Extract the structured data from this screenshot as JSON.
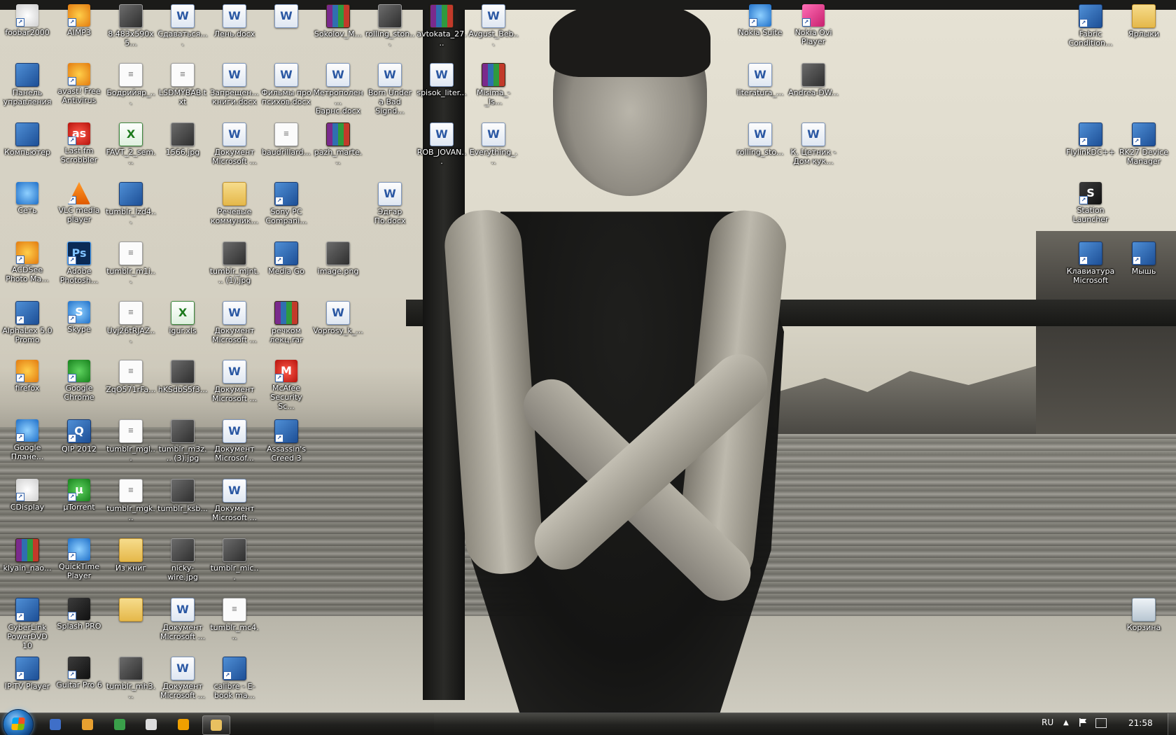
{
  "desktop": {
    "icons": [
      {
        "label": "foobar2000",
        "kind": "app",
        "icon": "foobar-icon"
      },
      {
        "label": "AIMP3",
        "kind": "app",
        "icon": "aimp-icon"
      },
      {
        "label": "8.483x590x5...",
        "kind": "img",
        "icon": "image-icon"
      },
      {
        "label": "Сдаваться....",
        "kind": "doc",
        "icon": "word-doc-icon"
      },
      {
        "label": "Лень.docx",
        "kind": "doc",
        "icon": "word-doc-icon"
      },
      {
        "label": "",
        "kind": "doc",
        "icon": "word-doc-icon"
      },
      {
        "label": "Sokolov_M...",
        "kind": "rar",
        "icon": "rar-archive-icon"
      },
      {
        "label": "rolling_ston...",
        "kind": "img",
        "icon": "image-icon"
      },
      {
        "label": "avtokata_27...",
        "kind": "rar",
        "icon": "rar-archive-icon"
      },
      {
        "label": "Avgust_Beb...",
        "kind": "doc",
        "icon": "word-doc-icon"
      },
      {
        "label": "Nokia Suite",
        "kind": "app",
        "icon": "nokia-suite-icon"
      },
      {
        "label": "Nokia Ovi Player",
        "kind": "app",
        "icon": "nokia-ovi-icon"
      },
      {
        "label": "Fabric Condition...",
        "kind": "app",
        "icon": "fabric-icon"
      },
      {
        "label": "Ярлыки",
        "kind": "folder",
        "icon": "folder-icon"
      },
      {
        "label": "Панель управления",
        "kind": "app",
        "icon": "control-panel-icon"
      },
      {
        "label": "avast! Free Antivirus",
        "kind": "app",
        "icon": "avast-icon"
      },
      {
        "label": "Бодрийяр_...",
        "kind": "txt",
        "icon": "text-file-icon"
      },
      {
        "label": "LSDMYBAB.txt",
        "kind": "txt",
        "icon": "text-file-icon"
      },
      {
        "label": "Запрещен... книги.docx",
        "kind": "doc",
        "icon": "word-doc-icon"
      },
      {
        "label": "Фильмы про психов.docx",
        "kind": "doc",
        "icon": "word-doc-icon"
      },
      {
        "label": "Метрополен... Барнс.docx",
        "kind": "doc",
        "icon": "word-doc-icon"
      },
      {
        "label": "Born Under a Bad Signd...",
        "kind": "doc",
        "icon": "word-doc-icon"
      },
      {
        "label": "spisok_liter...",
        "kind": "doc",
        "icon": "word-doc-icon"
      },
      {
        "label": "Misima_-_Is...",
        "kind": "rar",
        "icon": "rar-archive-icon"
      },
      {
        "label": "literatura_...",
        "kind": "doc",
        "icon": "word-doc-icon"
      },
      {
        "label": "Andrea-DW...",
        "kind": "img",
        "icon": "image-icon"
      },
      {
        "label": "Компьютер",
        "kind": "app",
        "icon": "computer-icon"
      },
      {
        "label": "Last.fm Scrobbler",
        "kind": "app",
        "icon": "lastfm-icon"
      },
      {
        "label": "FAVT_2_sem...",
        "kind": "xls",
        "icon": "excel-icon"
      },
      {
        "label": "1566.jpg",
        "kind": "img",
        "icon": "image-icon"
      },
      {
        "label": "Документ Microsoft ...",
        "kind": "doc",
        "icon": "word-doc-icon"
      },
      {
        "label": "baudrillard...",
        "kind": "txt",
        "icon": "text-file-icon"
      },
      {
        "label": "pazh_marte...",
        "kind": "rar",
        "icon": "rar-archive-icon"
      },
      {
        "label": "ROB_JOVAN...",
        "kind": "doc",
        "icon": "word-doc-icon"
      },
      {
        "label": "Everything_...",
        "kind": "doc",
        "icon": "word-doc-icon"
      },
      {
        "label": "rolling_sto...",
        "kind": "doc",
        "icon": "word-doc-icon"
      },
      {
        "label": "К. Цетник - Дом кук...",
        "kind": "doc",
        "icon": "word-doc-icon"
      },
      {
        "label": "FlylinkDC++",
        "kind": "app",
        "icon": "flylink-icon"
      },
      {
        "label": "RK27 Device Manager",
        "kind": "app",
        "icon": "device-manager-icon"
      },
      {
        "label": "Сеть",
        "kind": "app",
        "icon": "network-icon"
      },
      {
        "label": "VLC media player",
        "kind": "app",
        "icon": "vlc-icon"
      },
      {
        "label": "tumblr_lzd4...",
        "kind": "doc",
        "icon": "blue-doc-icon"
      },
      {
        "label": "Речевые коммуник...",
        "kind": "folder",
        "icon": "folder-icon"
      },
      {
        "label": "Sony PC Compani...",
        "kind": "app",
        "icon": "sony-pc-icon"
      },
      {
        "label": "Эдгар По.docx",
        "kind": "doc",
        "icon": "word-doc-icon"
      },
      {
        "label": "Station Launcher",
        "kind": "app",
        "icon": "station-launcher-icon"
      },
      {
        "label": "ACDSee Photo Ma...",
        "kind": "app",
        "icon": "acdsee-icon"
      },
      {
        "label": "Adobe Photosh...",
        "kind": "app",
        "icon": "photoshop-icon"
      },
      {
        "label": "tumblr_m1i...",
        "kind": "txt",
        "icon": "text-file-icon"
      },
      {
        "label": "tumblr_mjnt... (1).jpg",
        "kind": "img",
        "icon": "image-icon"
      },
      {
        "label": "Media Go",
        "kind": "app",
        "icon": "media-go-icon"
      },
      {
        "label": "image.png",
        "kind": "img",
        "icon": "image-icon"
      },
      {
        "label": "Клавиатура Microsoft",
        "kind": "app",
        "icon": "keyboard-icon"
      },
      {
        "label": "Мышь",
        "kind": "app",
        "icon": "mouse-icon"
      },
      {
        "label": "AlphaLex 5.0 Promo",
        "kind": "app",
        "icon": "alphalex-icon"
      },
      {
        "label": "Skype",
        "kind": "app",
        "icon": "skype-icon"
      },
      {
        "label": "Uvj26tRJAZ...",
        "kind": "txt",
        "icon": "text-file-icon"
      },
      {
        "label": "igur.xls",
        "kind": "xls",
        "icon": "excel-icon"
      },
      {
        "label": "Документ Microsoft ...",
        "kind": "doc",
        "icon": "word-doc-icon"
      },
      {
        "label": "речком лекц.rar",
        "kind": "rar",
        "icon": "rar-archive-icon"
      },
      {
        "label": "Voprosy_k_...",
        "kind": "doc",
        "icon": "word-doc-icon"
      },
      {
        "label": "firefox",
        "kind": "app",
        "icon": "firefox-icon"
      },
      {
        "label": "Google Chrome",
        "kind": "app",
        "icon": "chrome-icon"
      },
      {
        "label": "ZqO571rFa...",
        "kind": "txt",
        "icon": "text-file-icon"
      },
      {
        "label": "hKSdbS5f3...",
        "kind": "img",
        "icon": "image-icon"
      },
      {
        "label": "Документ Microsoft ...",
        "kind": "doc",
        "icon": "word-doc-icon"
      },
      {
        "label": "McAfee Security Sc...",
        "kind": "app",
        "icon": "mcafee-icon"
      },
      {
        "label": "Google Плане...",
        "kind": "app",
        "icon": "google-earth-icon"
      },
      {
        "label": "QIP 2012",
        "kind": "app",
        "icon": "qip-icon"
      },
      {
        "label": "tumblr_mgl...",
        "kind": "txt",
        "icon": "text-file-icon"
      },
      {
        "label": "tumblr_m3z... (3).jpg",
        "kind": "img",
        "icon": "image-icon"
      },
      {
        "label": "Документ Microsof...",
        "kind": "doc",
        "icon": "word-doc-icon"
      },
      {
        "label": "Assassin's Creed 3",
        "kind": "app",
        "icon": "assassins-creed-icon"
      },
      {
        "label": "CDisplay",
        "kind": "app",
        "icon": "cdisplay-icon"
      },
      {
        "label": "µTorrent",
        "kind": "app",
        "icon": "utorrent-icon"
      },
      {
        "label": "tumblr_mgk...",
        "kind": "txt",
        "icon": "text-file-icon"
      },
      {
        "label": "tumblr_ksb...",
        "kind": "img",
        "icon": "image-icon"
      },
      {
        "label": "Документ Microsoft ...",
        "kind": "doc",
        "icon": "word-doc-icon"
      },
      {
        "label": "klyain_nao...",
        "kind": "rar",
        "icon": "rar-archive-icon"
      },
      {
        "label": "QuickTime Player",
        "kind": "app",
        "icon": "quicktime-icon"
      },
      {
        "label": "Из книг",
        "kind": "folder",
        "icon": "folder-icon"
      },
      {
        "label": "nicky-wire.jpg",
        "kind": "img",
        "icon": "image-icon"
      },
      {
        "label": "tumblr_mic...",
        "kind": "img",
        "icon": "image-icon"
      },
      {
        "label": "CyberLink PowerDVD 10",
        "kind": "app",
        "icon": "powerdvd-icon"
      },
      {
        "label": "Splash PRO",
        "kind": "app",
        "icon": "splash-icon"
      },
      {
        "label": "",
        "kind": "folder",
        "icon": "folder-icon"
      },
      {
        "label": "Документ Microsoft ...",
        "kind": "doc",
        "icon": "word-doc-icon"
      },
      {
        "label": "tumblr_mc4...",
        "kind": "txt",
        "icon": "text-file-icon"
      },
      {
        "label": "Корзина",
        "kind": "app",
        "icon": "recycle-bin-icon"
      },
      {
        "label": "IP-TV Player",
        "kind": "app",
        "icon": "iptv-icon"
      },
      {
        "label": "Guitar Pro 6",
        "kind": "app",
        "icon": "guitar-pro-icon"
      },
      {
        "label": "tumblr_mh3...",
        "kind": "img",
        "icon": "image-icon"
      },
      {
        "label": "Документ Microsoft ...",
        "kind": "doc",
        "icon": "word-doc-icon"
      },
      {
        "label": "calibre - E-book ma...",
        "kind": "app",
        "icon": "calibre-icon"
      }
    ]
  },
  "taskbar": {
    "pinned": [
      {
        "name": "save-icon",
        "color": "#3f6fc8"
      },
      {
        "name": "media-icon",
        "color": "#e8a030"
      },
      {
        "name": "chrome-icon",
        "color": "#3aa04a"
      },
      {
        "name": "foobar-icon",
        "color": "#dddddd"
      },
      {
        "name": "aimp-icon",
        "color": "#f0a000"
      },
      {
        "name": "explorer-folder-icon",
        "color": "#e8c060"
      }
    ],
    "language": "RU",
    "clock": "21:58"
  }
}
